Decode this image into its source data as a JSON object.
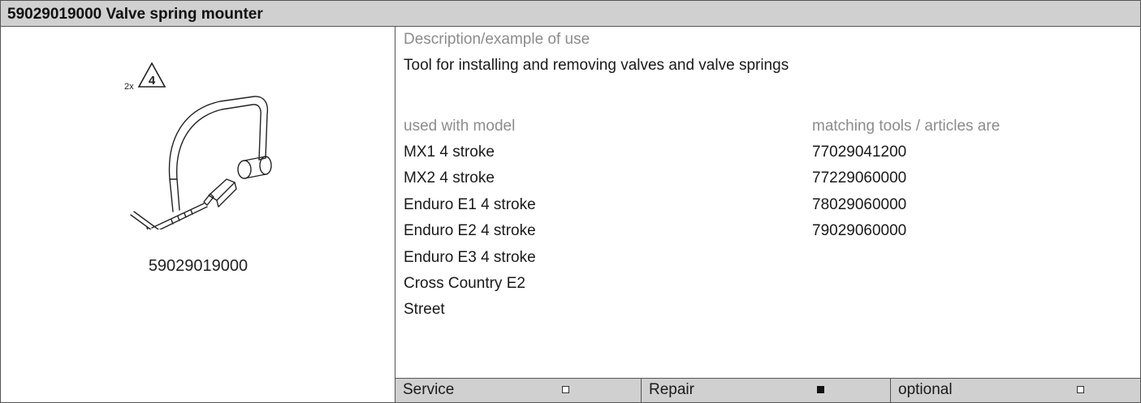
{
  "header": {
    "title": "59029019000 Valve spring mounter"
  },
  "tool": {
    "quantity_label": "2x",
    "warning_icon": "warning-triangle-4-icon",
    "warning_number": "4",
    "illustration_icon": "valve-spring-mounter-icon",
    "part_number": "59029019000"
  },
  "description": {
    "label": "Description/example of use",
    "text": "Tool for installing and removing valves and valve springs"
  },
  "models": {
    "header": "used with model",
    "items": [
      "MX1 4 stroke",
      "MX2 4 stroke",
      "Enduro E1 4 stroke",
      "Enduro E2 4 stroke",
      "Enduro E3 4 stroke",
      "Cross Country E2",
      "Street"
    ]
  },
  "articles": {
    "header": "matching tools / articles are",
    "items": [
      "77029041200",
      "77229060000",
      "78029060000",
      "79029060000"
    ]
  },
  "footer": {
    "service": {
      "label": "Service",
      "checked": false
    },
    "repair": {
      "label": "Repair",
      "checked": true
    },
    "optional": {
      "label": "optional",
      "checked": false
    }
  },
  "colors": {
    "header_bg": "#d0d0d0",
    "label_grey": "#8c8c8c",
    "border": "#555555"
  }
}
